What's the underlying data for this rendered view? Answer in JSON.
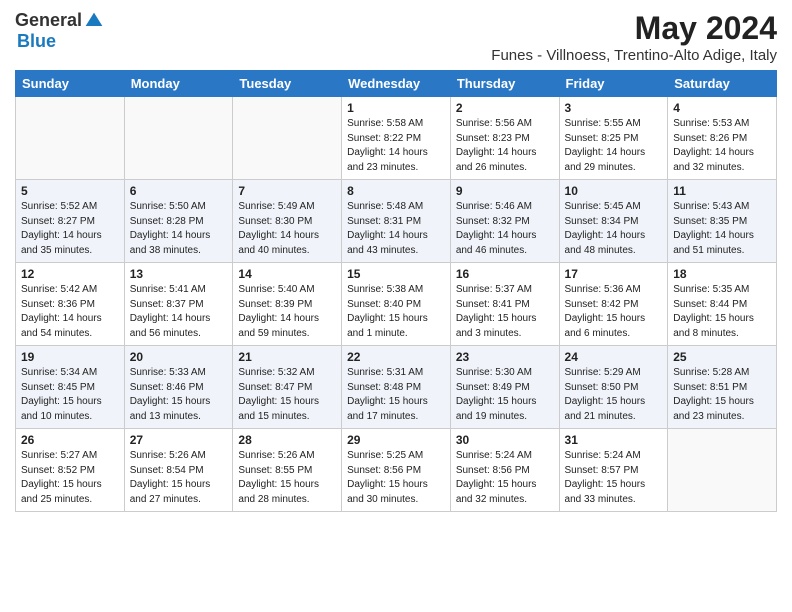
{
  "logo": {
    "general": "General",
    "blue": "Blue"
  },
  "title": "May 2024",
  "subtitle": "Funes - Villnoess, Trentino-Alto Adige, Italy",
  "headers": [
    "Sunday",
    "Monday",
    "Tuesday",
    "Wednesday",
    "Thursday",
    "Friday",
    "Saturday"
  ],
  "weeks": [
    [
      {
        "day": "",
        "info": ""
      },
      {
        "day": "",
        "info": ""
      },
      {
        "day": "",
        "info": ""
      },
      {
        "day": "1",
        "info": "Sunrise: 5:58 AM\nSunset: 8:22 PM\nDaylight: 14 hours\nand 23 minutes."
      },
      {
        "day": "2",
        "info": "Sunrise: 5:56 AM\nSunset: 8:23 PM\nDaylight: 14 hours\nand 26 minutes."
      },
      {
        "day": "3",
        "info": "Sunrise: 5:55 AM\nSunset: 8:25 PM\nDaylight: 14 hours\nand 29 minutes."
      },
      {
        "day": "4",
        "info": "Sunrise: 5:53 AM\nSunset: 8:26 PM\nDaylight: 14 hours\nand 32 minutes."
      }
    ],
    [
      {
        "day": "5",
        "info": "Sunrise: 5:52 AM\nSunset: 8:27 PM\nDaylight: 14 hours\nand 35 minutes."
      },
      {
        "day": "6",
        "info": "Sunrise: 5:50 AM\nSunset: 8:28 PM\nDaylight: 14 hours\nand 38 minutes."
      },
      {
        "day": "7",
        "info": "Sunrise: 5:49 AM\nSunset: 8:30 PM\nDaylight: 14 hours\nand 40 minutes."
      },
      {
        "day": "8",
        "info": "Sunrise: 5:48 AM\nSunset: 8:31 PM\nDaylight: 14 hours\nand 43 minutes."
      },
      {
        "day": "9",
        "info": "Sunrise: 5:46 AM\nSunset: 8:32 PM\nDaylight: 14 hours\nand 46 minutes."
      },
      {
        "day": "10",
        "info": "Sunrise: 5:45 AM\nSunset: 8:34 PM\nDaylight: 14 hours\nand 48 minutes."
      },
      {
        "day": "11",
        "info": "Sunrise: 5:43 AM\nSunset: 8:35 PM\nDaylight: 14 hours\nand 51 minutes."
      }
    ],
    [
      {
        "day": "12",
        "info": "Sunrise: 5:42 AM\nSunset: 8:36 PM\nDaylight: 14 hours\nand 54 minutes."
      },
      {
        "day": "13",
        "info": "Sunrise: 5:41 AM\nSunset: 8:37 PM\nDaylight: 14 hours\nand 56 minutes."
      },
      {
        "day": "14",
        "info": "Sunrise: 5:40 AM\nSunset: 8:39 PM\nDaylight: 14 hours\nand 59 minutes."
      },
      {
        "day": "15",
        "info": "Sunrise: 5:38 AM\nSunset: 8:40 PM\nDaylight: 15 hours\nand 1 minute."
      },
      {
        "day": "16",
        "info": "Sunrise: 5:37 AM\nSunset: 8:41 PM\nDaylight: 15 hours\nand 3 minutes."
      },
      {
        "day": "17",
        "info": "Sunrise: 5:36 AM\nSunset: 8:42 PM\nDaylight: 15 hours\nand 6 minutes."
      },
      {
        "day": "18",
        "info": "Sunrise: 5:35 AM\nSunset: 8:44 PM\nDaylight: 15 hours\nand 8 minutes."
      }
    ],
    [
      {
        "day": "19",
        "info": "Sunrise: 5:34 AM\nSunset: 8:45 PM\nDaylight: 15 hours\nand 10 minutes."
      },
      {
        "day": "20",
        "info": "Sunrise: 5:33 AM\nSunset: 8:46 PM\nDaylight: 15 hours\nand 13 minutes."
      },
      {
        "day": "21",
        "info": "Sunrise: 5:32 AM\nSunset: 8:47 PM\nDaylight: 15 hours\nand 15 minutes."
      },
      {
        "day": "22",
        "info": "Sunrise: 5:31 AM\nSunset: 8:48 PM\nDaylight: 15 hours\nand 17 minutes."
      },
      {
        "day": "23",
        "info": "Sunrise: 5:30 AM\nSunset: 8:49 PM\nDaylight: 15 hours\nand 19 minutes."
      },
      {
        "day": "24",
        "info": "Sunrise: 5:29 AM\nSunset: 8:50 PM\nDaylight: 15 hours\nand 21 minutes."
      },
      {
        "day": "25",
        "info": "Sunrise: 5:28 AM\nSunset: 8:51 PM\nDaylight: 15 hours\nand 23 minutes."
      }
    ],
    [
      {
        "day": "26",
        "info": "Sunrise: 5:27 AM\nSunset: 8:52 PM\nDaylight: 15 hours\nand 25 minutes."
      },
      {
        "day": "27",
        "info": "Sunrise: 5:26 AM\nSunset: 8:54 PM\nDaylight: 15 hours\nand 27 minutes."
      },
      {
        "day": "28",
        "info": "Sunrise: 5:26 AM\nSunset: 8:55 PM\nDaylight: 15 hours\nand 28 minutes."
      },
      {
        "day": "29",
        "info": "Sunrise: 5:25 AM\nSunset: 8:56 PM\nDaylight: 15 hours\nand 30 minutes."
      },
      {
        "day": "30",
        "info": "Sunrise: 5:24 AM\nSunset: 8:56 PM\nDaylight: 15 hours\nand 32 minutes."
      },
      {
        "day": "31",
        "info": "Sunrise: 5:24 AM\nSunset: 8:57 PM\nDaylight: 15 hours\nand 33 minutes."
      },
      {
        "day": "",
        "info": ""
      }
    ]
  ]
}
